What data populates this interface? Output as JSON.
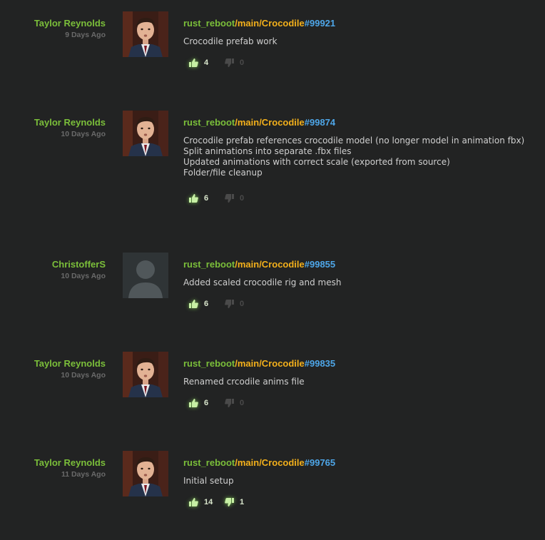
{
  "commits": [
    {
      "author": "Taylor Reynolds",
      "date": "9 Days Ago",
      "avatar": "photo-avatar",
      "repo": "rust_reboot",
      "branch": "/main/Crocodile",
      "changeset": "#99921",
      "message": [
        "Crocodile prefab work"
      ],
      "likes": "4",
      "dislikes": "0"
    },
    {
      "author": "Taylor Reynolds",
      "date": "10 Days Ago",
      "avatar": "photo-avatar",
      "repo": "rust_reboot",
      "branch": "/main/Crocodile",
      "changeset": "#99874",
      "message": [
        "Crocodile prefab references crocodile model (no longer model in animation fbx)",
        "Split animations into separate .fbx files",
        "Updated animations with correct scale (exported from source)",
        "Folder/file cleanup"
      ],
      "likes": "6",
      "dislikes": "0"
    },
    {
      "author": "ChristofferS",
      "date": "10 Days Ago",
      "avatar": "default-avatar",
      "repo": "rust_reboot",
      "branch": "/main/Crocodile",
      "changeset": "#99855",
      "message": [
        "Added scaled crocodile rig and mesh"
      ],
      "likes": "6",
      "dislikes": "0"
    },
    {
      "author": "Taylor Reynolds",
      "date": "10 Days Ago",
      "avatar": "photo-avatar",
      "repo": "rust_reboot",
      "branch": "/main/Crocodile",
      "changeset": "#99835",
      "message": [
        "Renamed crcodile anims file"
      ],
      "likes": "6",
      "dislikes": "0"
    },
    {
      "author": "Taylor Reynolds",
      "date": "11 Days Ago",
      "avatar": "photo-avatar",
      "repo": "rust_reboot",
      "branch": "/main/Crocodile",
      "changeset": "#99765",
      "message": [
        "Initial setup"
      ],
      "likes": "14",
      "dislikes": "1"
    }
  ],
  "icons": {
    "like": "thumbs-up-icon",
    "dislike": "thumbs-down-icon"
  },
  "colors": {
    "background": "#222323",
    "author": "#7bbf3a",
    "repo": "#7bbf3a",
    "branch": "#f3b01b",
    "changeset": "#4ea6e8",
    "message": "#cfcfcf",
    "date": "#6a6a6a"
  }
}
